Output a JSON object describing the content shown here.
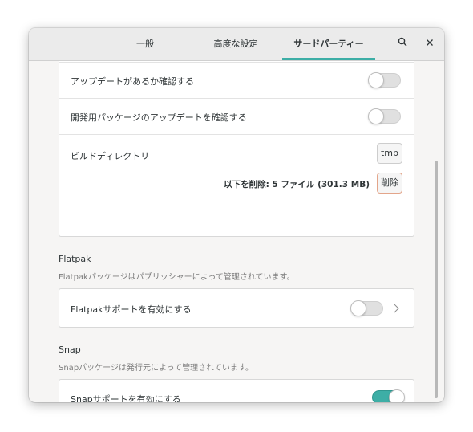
{
  "header": {
    "tabs": [
      {
        "label": "一般",
        "active": false
      },
      {
        "label": "高度な設定",
        "active": false
      },
      {
        "label": "サードパーティー",
        "active": true
      }
    ],
    "search_icon": "search-icon",
    "close_icon": "close-icon",
    "search_glyph": "⌕",
    "close_glyph": "×",
    "accent_color": "#3daea6"
  },
  "updates_card": {
    "check_updates_label": "アップデートがあるか確認する",
    "check_updates_state": false,
    "check_dev_updates_label": "開発用パッケージのアップデートを確認する",
    "check_dev_updates_state": false,
    "build_dir_label": "ビルドディレクトリ",
    "build_dir_button": "tmp",
    "delete_info": "以下を削除: 5 ファイル (301.3 MB)",
    "delete_button": "削除"
  },
  "flatpak": {
    "title": "Flatpak",
    "description": "Flatpakパッケージはパブリッシャーによって管理されています。",
    "enable_label": "Flatpakサポートを有効にする",
    "enable_state": false
  },
  "snap": {
    "title": "Snap",
    "description": "Snapパッケージは発行元によって管理されています。",
    "enable_label": "Snapサポートを有効にする",
    "enable_state": true
  }
}
